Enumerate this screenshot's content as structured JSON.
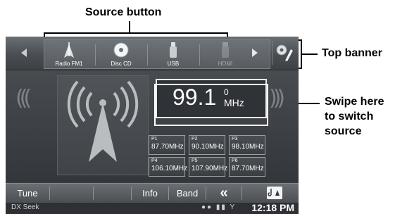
{
  "annotations": {
    "source_button": "Source button",
    "top_banner": "Top banner",
    "swipe_line1": "Swipe here",
    "swipe_line2": "to switch",
    "swipe_line3": "source"
  },
  "sources": [
    {
      "label": "Radio FM1",
      "icon": "radio-antenna-icon"
    },
    {
      "label": "Disc CD",
      "icon": "disc-icon"
    },
    {
      "label": "USB",
      "icon": "usb-icon"
    },
    {
      "label": "HDMI",
      "icon": "hdmi-icon"
    }
  ],
  "frequency": {
    "value": "99.1",
    "superscript": "0",
    "unit": "MHz"
  },
  "presets": [
    {
      "num": "P1",
      "freq": "87.70MHz"
    },
    {
      "num": "P2",
      "freq": "90.10MHz"
    },
    {
      "num": "P3",
      "freq": "98.10MHz"
    },
    {
      "num": "P4",
      "freq": "106.10MHz"
    },
    {
      "num": "P5",
      "freq": "107.90MHz"
    },
    {
      "num": "P6",
      "freq": "87.70MHz"
    }
  ],
  "bottom": {
    "tune": "Tune",
    "info": "Info",
    "band": "Band",
    "back": "«"
  },
  "status": {
    "mode": "DX Seek",
    "clock": "12:18 PM"
  },
  "colors": {
    "screen_bg": "#3a3d40",
    "accent_white": "#ffffff"
  }
}
